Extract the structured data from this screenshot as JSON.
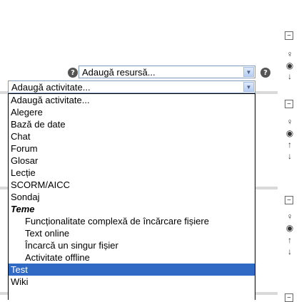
{
  "resource_select": {
    "value": "Adaugă resursă..."
  },
  "activity_select": {
    "value": "Adaugă activitate..."
  },
  "activity_options": [
    {
      "label": "Adaugă activitate...",
      "kind": "option"
    },
    {
      "label": "Alegere",
      "kind": "option"
    },
    {
      "label": "Bază de date",
      "kind": "option"
    },
    {
      "label": "Chat",
      "kind": "option"
    },
    {
      "label": "Forum",
      "kind": "option"
    },
    {
      "label": "Glosar",
      "kind": "option"
    },
    {
      "label": "Lecție",
      "kind": "option"
    },
    {
      "label": "SCORM/AICC",
      "kind": "option"
    },
    {
      "label": "Sondaj",
      "kind": "option"
    },
    {
      "label": "Teme",
      "kind": "group"
    },
    {
      "label": "Funcționalitate complexă de încărcare fișiere",
      "kind": "sub"
    },
    {
      "label": "Text online",
      "kind": "sub"
    },
    {
      "label": "Încarcă un singur fișier",
      "kind": "sub"
    },
    {
      "label": "Activitate offline",
      "kind": "sub"
    },
    {
      "label": "Test",
      "kind": "selected"
    },
    {
      "label": "Wiki",
      "kind": "option"
    }
  ],
  "colors": {
    "highlight": "#316ac5",
    "separator": "#d9d9d9"
  }
}
